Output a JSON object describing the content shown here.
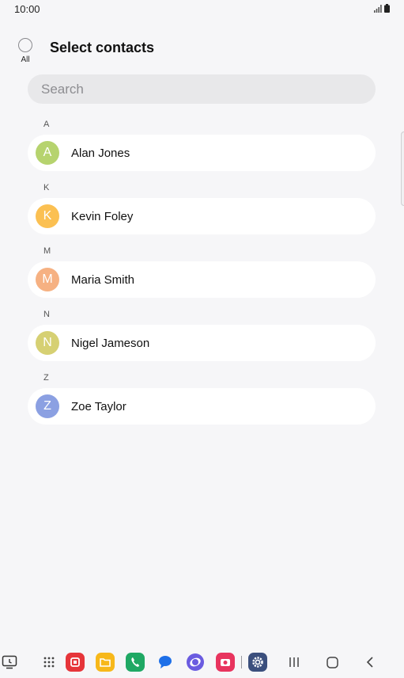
{
  "status_bar": {
    "time": "10:00"
  },
  "header": {
    "select_all_label": "All",
    "title": "Select contacts"
  },
  "search": {
    "placeholder": "Search"
  },
  "sections": [
    {
      "letter": "A",
      "contacts": [
        {
          "name": "Alan Jones",
          "initial": "A",
          "color": "#b6d36e"
        }
      ]
    },
    {
      "letter": "K",
      "contacts": [
        {
          "name": "Kevin Foley",
          "initial": "K",
          "color": "#fbc052"
        }
      ]
    },
    {
      "letter": "M",
      "contacts": [
        {
          "name": "Maria Smith",
          "initial": "M",
          "color": "#f6b182"
        }
      ]
    },
    {
      "letter": "N",
      "contacts": [
        {
          "name": "Nigel Jameson",
          "initial": "N",
          "color": "#d6d073"
        }
      ]
    },
    {
      "letter": "Z",
      "contacts": [
        {
          "name": "Zoe Taylor",
          "initial": "Z",
          "color": "#8ba0e2"
        }
      ]
    }
  ],
  "nav_bar": {
    "icons": [
      "screen-capture-icon",
      "apps-grid-icon",
      "flipboard-app-icon",
      "files-app-icon",
      "phone-app-icon",
      "messages-app-icon",
      "internet-app-icon",
      "camera-app-icon",
      "settings-app-icon",
      "recents-icon",
      "home-icon",
      "back-icon"
    ]
  }
}
